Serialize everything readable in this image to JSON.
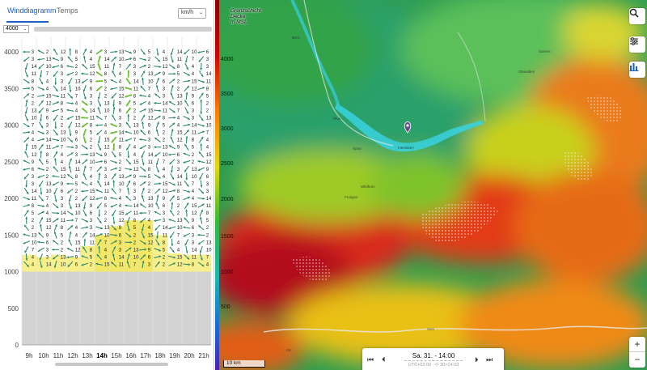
{
  "tabs": [
    {
      "label": "Winddiagramm",
      "active": true
    },
    {
      "label": "Temps",
      "active": false
    }
  ],
  "unit_select": {
    "value": "km/h"
  },
  "altitude_select": {
    "value": "4000"
  },
  "diagram": {
    "y_ticks": [
      "0",
      "500",
      "1000",
      "1500",
      "2000",
      "2500",
      "3000",
      "3500",
      "4000"
    ],
    "y_max": 4200,
    "ground_altitude": 1000,
    "hours": [
      "9h",
      "10h",
      "11h",
      "12h",
      "13h",
      "14h",
      "15h",
      "16h",
      "17h",
      "18h",
      "19h",
      "20h",
      "21h"
    ],
    "selected_hour": "14h",
    "colors": {
      "ground": "#d3d3d3",
      "thermal": "#f7ef8a",
      "thermal_strong": "#f3e866",
      "arrow": "#2f8a6e",
      "arrow_strong": "#6fbf3a"
    }
  },
  "map": {
    "legend_title": [
      "Grenzschicht",
      "Decke",
      "m MSL"
    ],
    "altitude_labels": [
      "4000",
      "3500",
      "3000",
      "2500",
      "2000",
      "1500",
      "1000",
      "500"
    ],
    "place_labels": [
      {
        "text": "Bern",
        "kind": "city"
      },
      {
        "text": "Thun",
        "kind": "city"
      },
      {
        "text": "Interlaken",
        "kind": "city"
      },
      {
        "text": "Spiez",
        "kind": "city"
      },
      {
        "text": "Frutigen",
        "kind": "city"
      },
      {
        "text": "Sion",
        "kind": "city"
      },
      {
        "text": "Obwalden",
        "kind": "region"
      },
      {
        "text": "Sarnen",
        "kind": "city"
      },
      {
        "text": "Wildhorn",
        "kind": "peak"
      }
    ],
    "road_label": "A9",
    "scale_label": "10 km",
    "icons": [
      "search-icon",
      "filter-sliders-icon",
      "bar-chart-icon"
    ],
    "colors": {
      "accent": "#1f5fbf",
      "pin": "#6b4c8a"
    }
  },
  "timebar": {
    "date": "Sa. 31. - 14:00",
    "utc_info": "UTC+02:00 · ⟳ 30×14:03"
  }
}
